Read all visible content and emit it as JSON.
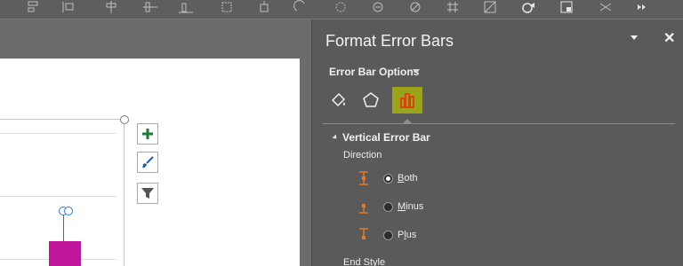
{
  "ribbon": {
    "icons": [
      "align-icon",
      "distribute-icon",
      "align-center-icon",
      "align-middle-icon",
      "align-bottom-icon",
      "group-icon",
      "shape-icon",
      "circle-icon",
      "rotate-icon",
      "merge-icon",
      "crop-icon",
      "edit-points-icon",
      "play-icon",
      "select-icon",
      "effects-icon",
      "more-icon"
    ]
  },
  "chart_buttons": [
    {
      "name": "chart-elements-button",
      "icon": "plus-icon"
    },
    {
      "name": "chart-styles-button",
      "icon": "brush-icon"
    },
    {
      "name": "chart-filters-button",
      "icon": "filter-icon"
    }
  ],
  "pane": {
    "title": "Format Error Bars",
    "close_glyph": "✕",
    "options_label": "Error Bar Options",
    "categories": [
      "fill-line-icon",
      "effects-pentagon-icon",
      "bar-options-icon"
    ],
    "active_category": "bar-options-icon",
    "section": "Vertical Error Bar",
    "direction_label": "Direction",
    "direction_options": [
      {
        "label": "Both",
        "underline": "B",
        "rest": "oth",
        "selected": true
      },
      {
        "label": "Minus",
        "underline": "M",
        "rest": "inus",
        "selected": false
      },
      {
        "label": "Plus",
        "underline": "l",
        "prefix": "P",
        "rest": "us",
        "selected": false
      }
    ],
    "end_style_label": "End Style"
  },
  "colors": {
    "accent_active_tab": "#9aa31a",
    "bar": "#c0169b",
    "error_glyph": "#e07a2c",
    "error_cap": "#2a7dd6",
    "pane_bg": "#5a5a5a"
  }
}
